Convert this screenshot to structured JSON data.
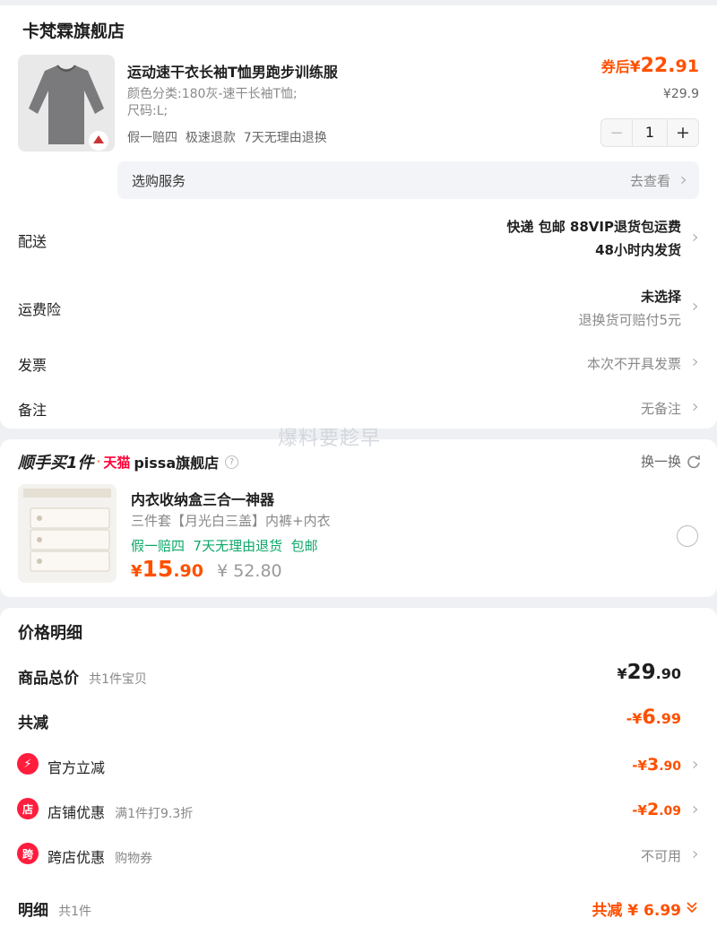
{
  "store": {
    "name": "卡梵霖旗舰店",
    "product": {
      "title": "运动速干衣长袖T恤男跑步训练服",
      "spec": "颜色分类:180灰-速干长袖T恤;尺码:L;",
      "tags": "假一赔四  极速退款  7天无理由退换",
      "after_coupon_prefix": "券后",
      "currency": "¥",
      "price_int": "22.",
      "price_dec": "91",
      "original_price": "¥29.9",
      "quantity": "1",
      "minus": "−",
      "plus": "+"
    },
    "service": {
      "label": "选购服务",
      "action": "去查看"
    },
    "delivery": {
      "label": "配送",
      "line1": "快递 包邮 88VIP退货包运费",
      "line2": "48小时内发货"
    },
    "insurance": {
      "label": "运费险",
      "line1": "未选择",
      "line2": "退换货可赔付5元"
    },
    "invoice": {
      "label": "发票",
      "value": "本次不开具发票"
    },
    "remark": {
      "label": "备注",
      "value": "无备注"
    }
  },
  "watermark": "爆料要趁早",
  "addon": {
    "brand": "顺手买1件",
    "dot": "·",
    "tmall": "天猫",
    "shop": "pissa旗舰店",
    "help_icon": "?",
    "swap": "换一换",
    "title": "内衣收纳盒三合一神器",
    "subtitle": "三件套【月光白三盖】内裤+内衣",
    "tags": "假一赔四  7天无理由退货  包邮",
    "currency": "¥",
    "price_int": "15",
    "price_dec": ".90",
    "original_price": "¥ 52.80"
  },
  "price_detail": {
    "title": "价格明细",
    "total_label": "商品总价",
    "total_sub": "共1件宝贝",
    "total_currency": "¥",
    "total_int": "29",
    "total_dec": ".90",
    "discount_label": "共减",
    "discount_prefix": "-¥",
    "discount_int": "6",
    "discount_dec": ".99",
    "rows": [
      {
        "icon": "⚡",
        "label": "官方立减",
        "sub": "",
        "prefix": "-¥",
        "int": "3",
        "dec": ".90"
      },
      {
        "icon": "店",
        "label": "店铺优惠",
        "sub": "满1件打9.3折",
        "prefix": "-¥",
        "int": "2",
        "dec": ".09"
      },
      {
        "icon": "跨",
        "label": "跨店优惠",
        "sub": "购物券",
        "value": "不可用"
      }
    ],
    "detail_label": "明细",
    "detail_sub": "共1件",
    "detail_value": "共减 ¥ 6.99"
  }
}
